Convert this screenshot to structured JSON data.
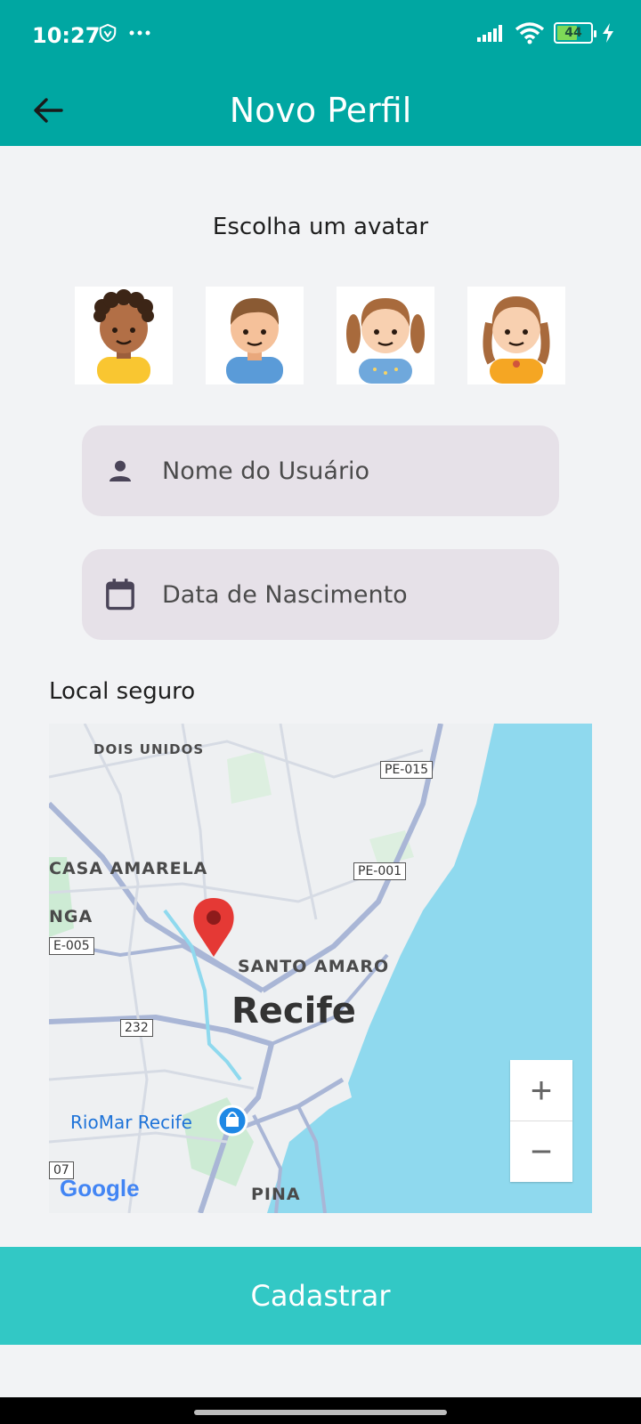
{
  "status": {
    "time": "10:27",
    "battery": "44"
  },
  "appbar": {
    "title": "Novo Perfil"
  },
  "avatar_section": {
    "heading": "Escolha um avatar",
    "avatars": [
      {
        "name": "avatar-boy-curly"
      },
      {
        "name": "avatar-boy"
      },
      {
        "name": "avatar-girl-pigtails"
      },
      {
        "name": "avatar-girl-braids"
      }
    ]
  },
  "form": {
    "name_placeholder": "Nome do Usuário",
    "birth_placeholder": "Data de Nascimento"
  },
  "map": {
    "label": "Local seguro",
    "places": {
      "dois_unidos": "DOIS UNIDOS",
      "casa_amarela": "CASA AMARELA",
      "nga": "NGA",
      "santo_amaro": "SANTO AMARO",
      "recife": "Recife",
      "riomar": "RioMar Recife",
      "pina": "PINA"
    },
    "roads": {
      "pe015": "PE-015",
      "pe001": "PE-001",
      "e005": "E-005",
      "r232": "232",
      "r07": "07"
    },
    "zoom_in": "+",
    "zoom_out": "−",
    "attribution": "Google",
    "colors": {
      "water": "#8FD9EE",
      "land": "#EEF0F2",
      "road": "#A9B6D6",
      "green": "#CDEBD4",
      "pin": "#E53935"
    }
  },
  "actions": {
    "submit_label": "Cadastrar"
  },
  "colors": {
    "primary": "#00A7A2",
    "button": "#32C8C5",
    "field_bg": "#E6E1E8"
  }
}
